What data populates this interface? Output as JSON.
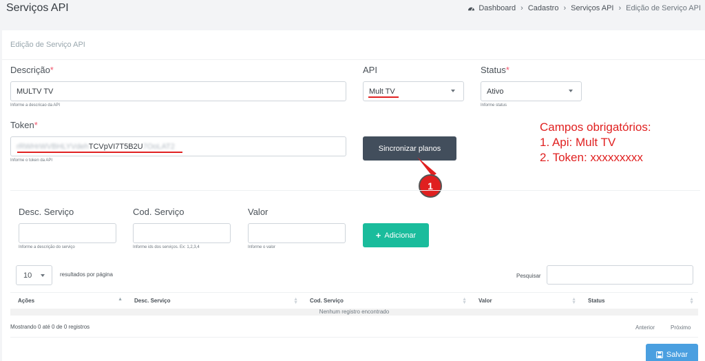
{
  "header": {
    "title": "Serviços API",
    "breadcrumb": [
      "Dashboard",
      "Cadastro",
      "Serviços API",
      "Edição de Serviço API"
    ]
  },
  "card": {
    "title": "Edição de Serviço API"
  },
  "form": {
    "descricao": {
      "label": "Descrição",
      "required_mark": "*",
      "value": "MULTV TV",
      "help": "Informe a descricao da API"
    },
    "api": {
      "label": "API",
      "value": "Mult TV"
    },
    "status": {
      "label": "Status",
      "required_mark": "*",
      "value": "Ativo",
      "help": "Informe status"
    },
    "token": {
      "label": "Token",
      "required_mark": "*",
      "value_prefix": "rRWHrWVBHLYVdeh",
      "value_visible": "TCVpVI7T5B2U",
      "value_suffix": "7OoLAT2",
      "help": "Informe o token da API"
    },
    "sync_button": "Sincronizar planos"
  },
  "annotation": {
    "lines": [
      "Campos obrigatórios:",
      "1. Api: Mult TV",
      "2. Token: xxxxxxxxx"
    ],
    "callout_number": "1",
    "color": "#e02020"
  },
  "servicos": {
    "desc": {
      "label": "Desc. Serviço",
      "help": "Informe a descrição do serviço"
    },
    "cod": {
      "label": "Cod. Serviço",
      "help": "Informe ids dos serviços. Ex: 1,2,3,4"
    },
    "valor": {
      "label": "Valor",
      "help": "Informe o valor"
    },
    "add_button": "Adicionar"
  },
  "table": {
    "page_length": "10",
    "page_length_label": "resultados por página",
    "search_label": "Pesquisar",
    "columns": [
      "Ações",
      "Desc. Serviço",
      "Cod. Serviço",
      "Valor",
      "Status"
    ],
    "empty_message": "Nenhum registro encontrado",
    "info": "Mostrando 0 até 0 de 0 registros",
    "prev": "Anterior",
    "next": "Próximo"
  },
  "save_button": "Salvar",
  "colors": {
    "primary": "#4a9fe0",
    "success": "#1abc9c",
    "dark": "#424e5c",
    "required": "#f1556c"
  }
}
